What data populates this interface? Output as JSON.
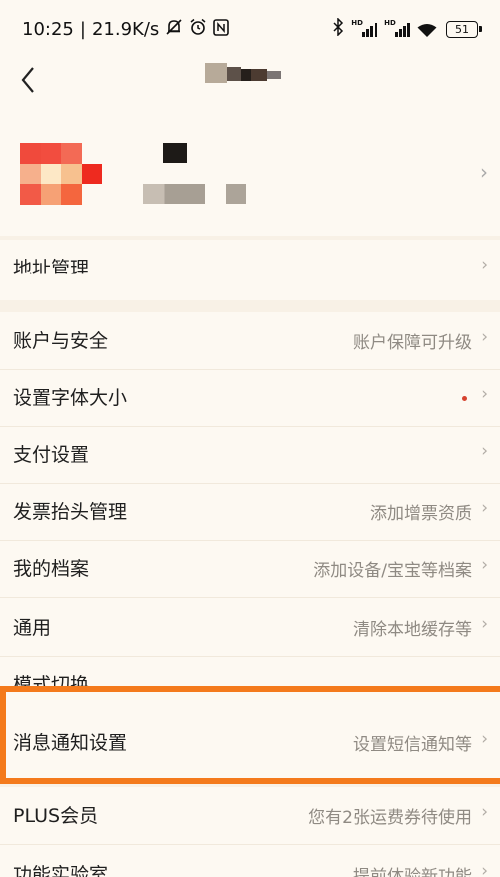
{
  "status_bar": {
    "time": "10:25",
    "separator": "|",
    "network_speed": "21.9K/s",
    "battery_level": "51",
    "icons": [
      "mute-bell-icon",
      "alarm-icon",
      "nfc-icon",
      "bluetooth-icon",
      "signal-hd-icon",
      "signal-hd-icon",
      "wifi-icon",
      "battery-icon"
    ]
  },
  "nav": {
    "back_glyph": "‹"
  },
  "profile": {
    "chevron": "›"
  },
  "menu": {
    "address": {
      "label": "地址管理",
      "chevron": "›"
    },
    "account_security": {
      "label": "账户与安全",
      "value": "账户保障可升级",
      "chevron": "›"
    },
    "font_size": {
      "label": "设置字体大小",
      "chevron": "›",
      "has_red_dot": true
    },
    "payment": {
      "label": "支付设置",
      "chevron": "›"
    },
    "invoice": {
      "label": "发票抬头管理",
      "value": "添加增票资质",
      "chevron": "›"
    },
    "archive": {
      "label": "我的档案",
      "value": "添加设备/宝宝等档案",
      "chevron": "›"
    },
    "general": {
      "label": "通用",
      "value": "清除本地缓存等",
      "chevron": "›"
    },
    "mode_switch": {
      "label": "模式切换"
    },
    "notification": {
      "label": "消息通知设置",
      "value": "设置短信通知等",
      "chevron": "›"
    },
    "plus": {
      "label": "PLUS会员",
      "value": "您有2张运费券待使用",
      "chevron": "›"
    },
    "lab": {
      "label": "功能实验室",
      "value": "提前体验新功能",
      "chevron": "›"
    }
  },
  "colors": {
    "background": "#fdf9f2",
    "highlight_border": "#f47a1c",
    "red_dot": "#d6432f",
    "secondary_text": "#8f8a83"
  }
}
